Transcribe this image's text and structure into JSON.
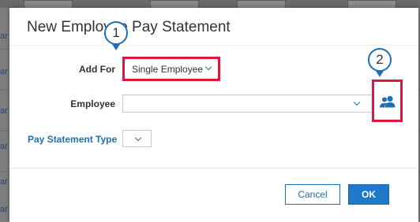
{
  "background": {
    "side_labels": [
      "ar",
      "ar",
      "ar",
      "ar",
      "ar",
      "ar"
    ]
  },
  "dialog": {
    "title": "New Employee Pay Statement"
  },
  "form": {
    "add_for_label": "Add For",
    "add_for_value": "Single Employee",
    "employee_label": "Employee",
    "employee_value": "",
    "pay_statement_type_label": "Pay Statement Type",
    "pay_statement_type_value": ""
  },
  "callouts": {
    "one": "1",
    "two": "2"
  },
  "buttons": {
    "cancel": "Cancel",
    "ok": "OK"
  },
  "colors": {
    "accent": "#1f6fb5",
    "highlight": "#e0173a",
    "ok_button": "#1f78c8"
  },
  "icons": {
    "employee_lookup": "people-icon",
    "dropdown": "chevron-down-icon"
  }
}
